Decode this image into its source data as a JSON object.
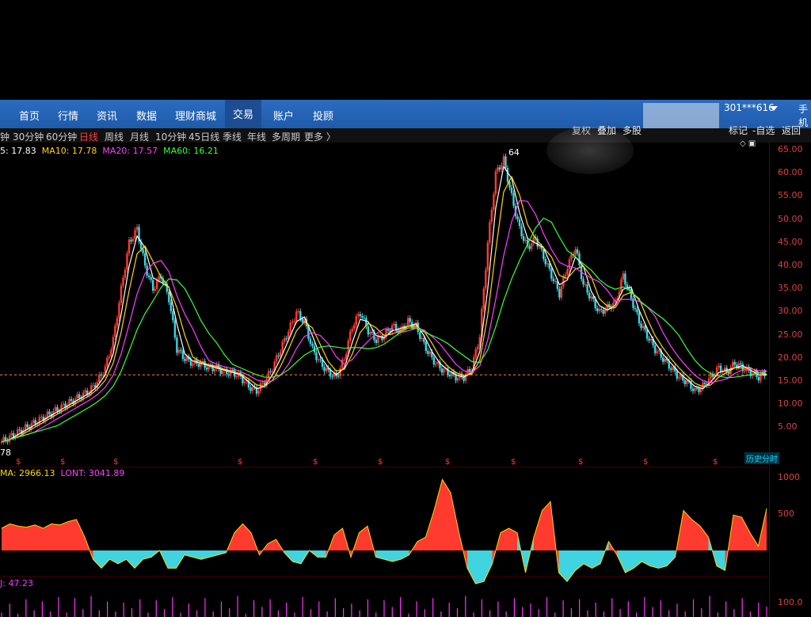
{
  "nav": {
    "items": [
      "首页",
      "行情",
      "资讯",
      "数据",
      "理财商城",
      "交易",
      "账户",
      "投顾"
    ],
    "active_index": 5,
    "account": "301***616",
    "mobile": "手机"
  },
  "periods": {
    "items": [
      "钟",
      "30分钟",
      "60分钟",
      "日线",
      "周线",
      "月线",
      "10分钟",
      "45日线",
      "季线",
      "年线",
      "多周期",
      "更多 〉"
    ],
    "active_index": 3
  },
  "tools": {
    "fuquan": "复权",
    "diejia": "叠加",
    "duogu": "多股",
    "biaoji": "标记",
    "zixuan": "-自选",
    "fanhui": "返回"
  },
  "ma_legend": {
    "ma5": "5: 17.83",
    "ma10": "MA10: 17.78",
    "ma20": "MA20: 17.57",
    "ma60": "MA60: 16.21"
  },
  "vol_legend": {
    "ma": "MA: 2966.13",
    "lont": "LONT: 3041.89"
  },
  "kdj_legend": "J: 47.23",
  "high_marker": "64",
  "low_marker": "78",
  "history_label": "历史分时",
  "price_axis": [
    "65.00",
    "60.00",
    "55.00",
    "50.00",
    "45.00",
    "40.00",
    "35.00",
    "30.00",
    "25.00",
    "20.00",
    "15.00",
    "10.00",
    "5.00"
  ],
  "vol_axis": [
    "1000",
    "500"
  ],
  "kdj_axis": "100.0",
  "colors": {
    "up": "#ff3b30",
    "down": "#3fd4e0",
    "ma5": "#ffffff",
    "ma10": "#ffd700",
    "ma20": "#ff40ff",
    "ma60": "#3dff3d",
    "nav_bg": "#2a6cc0",
    "axis": "#e04040"
  },
  "chart_data": {
    "type": "line",
    "price_series": [
      2,
      3,
      4,
      5,
      6,
      7,
      8,
      9,
      10,
      11,
      12,
      13,
      15,
      18,
      24,
      35,
      45,
      48,
      40,
      35,
      38,
      33,
      22,
      20,
      19,
      19,
      18,
      18,
      17,
      17,
      16,
      14,
      13,
      15,
      18,
      22,
      26,
      30,
      28,
      22,
      19,
      17,
      16,
      20,
      27,
      30,
      26,
      24,
      25,
      27,
      26,
      28,
      27,
      23,
      20,
      18,
      17,
      16,
      16,
      18,
      25,
      45,
      60,
      63,
      55,
      48,
      44,
      46,
      42,
      38,
      34,
      40,
      44,
      36,
      33,
      30,
      31,
      32,
      38,
      33,
      28,
      25,
      22,
      20,
      18,
      16,
      15,
      13,
      14,
      16,
      18,
      17,
      19,
      18,
      17,
      16,
      17
    ],
    "volume_oscillator": [
      100,
      120,
      110,
      105,
      115,
      100,
      120,
      115,
      130,
      140,
      60,
      -40,
      -80,
      -40,
      -60,
      -40,
      -80,
      -40,
      -30,
      0,
      -80,
      -80,
      -20,
      -30,
      -40,
      -30,
      -20,
      -10,
      80,
      120,
      80,
      -20,
      30,
      50,
      -10,
      -50,
      -60,
      0,
      -30,
      -30,
      70,
      100,
      -30,
      80,
      110,
      -30,
      -40,
      -50,
      -40,
      -20,
      40,
      60,
      180,
      320,
      260,
      80,
      -80,
      -150,
      -140,
      -60,
      80,
      100,
      80,
      -100,
      60,
      180,
      220,
      -100,
      -140,
      -90,
      -60,
      -80,
      -60,
      40,
      -20,
      -100,
      -80,
      -50,
      -70,
      -80,
      -70,
      -30,
      180,
      140,
      110,
      60,
      -70,
      -90,
      160,
      150,
      80,
      20,
      190
    ],
    "kdj_j": [
      20,
      60,
      15,
      80,
      30,
      70,
      25,
      90,
      20,
      85,
      35,
      95,
      30,
      70,
      25,
      65,
      40,
      80,
      20,
      75,
      35,
      90,
      20,
      60,
      30,
      85,
      25,
      70,
      40,
      95,
      15,
      75,
      45,
      80,
      30,
      65,
      20,
      90,
      35,
      70,
      25,
      85,
      40,
      60,
      30,
      80,
      20,
      75,
      45,
      90,
      15,
      70,
      35,
      85,
      25,
      65,
      40,
      95,
      20,
      80,
      30,
      70,
      25,
      85,
      45,
      60,
      35,
      90,
      20,
      75,
      40,
      80,
      30,
      65,
      25,
      85,
      35,
      70,
      20,
      90,
      45,
      75,
      30,
      60,
      25,
      80,
      40,
      95,
      20,
      70,
      35,
      85,
      25,
      65,
      47
    ]
  }
}
